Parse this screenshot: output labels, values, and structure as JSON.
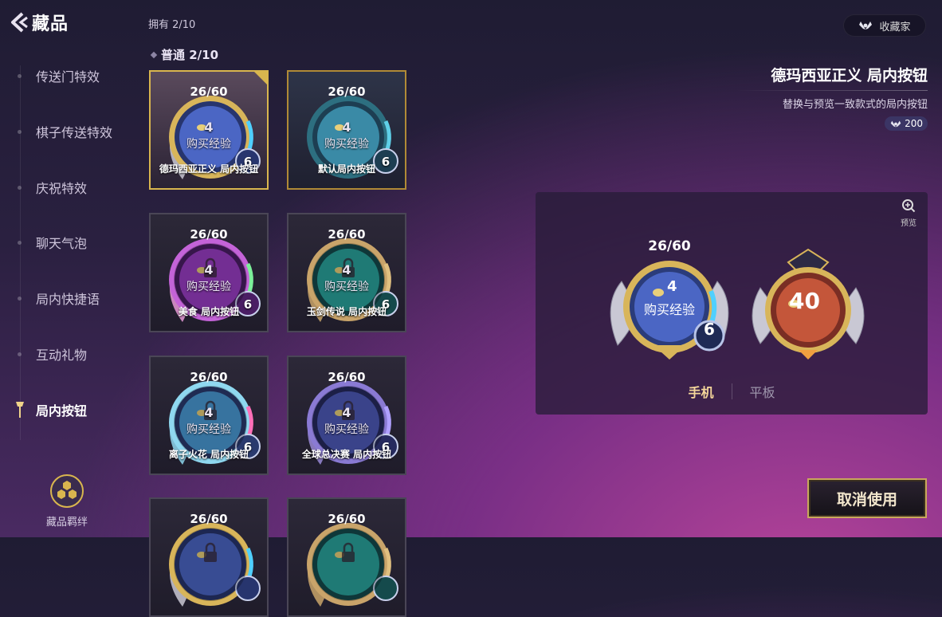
{
  "header": {
    "title": "藏品",
    "owned": "拥有 2/10",
    "collector_button": "收藏家"
  },
  "sidebar": {
    "items": [
      {
        "label": "传送门特效",
        "active": false
      },
      {
        "label": "棋子传送特效",
        "active": false
      },
      {
        "label": "庆祝特效",
        "active": false
      },
      {
        "label": "聊天气泡",
        "active": false
      },
      {
        "label": "局内快捷语",
        "active": false
      },
      {
        "label": "互动礼物",
        "active": false
      },
      {
        "label": "局内按钮",
        "active": true
      }
    ],
    "bond_label": "藏品羁绊"
  },
  "grid": {
    "section_label": "普通 2/10",
    "cards": [
      {
        "count": "26/60",
        "coin": "4",
        "buy": "购买经验",
        "level": "6",
        "name": "德玛西亚正义  局内按钮",
        "theme": "demacia",
        "state": "equipped"
      },
      {
        "count": "26/60",
        "coin": "4",
        "buy": "购买经验",
        "level": "6",
        "name": "默认局内按钮",
        "theme": "default",
        "state": "owned"
      },
      {
        "count": "26/60",
        "coin": "4",
        "buy": "购买经验",
        "level": "6",
        "name": "美食  局内按钮",
        "theme": "purple",
        "state": "locked"
      },
      {
        "count": "26/60",
        "coin": "4",
        "buy": "购买经验",
        "level": "6",
        "name": "玉剑传说  局内按钮",
        "theme": "teal",
        "state": "locked"
      },
      {
        "count": "26/60",
        "coin": "4",
        "buy": "购买经验",
        "level": "6",
        "name": "离子火花  局内按钮",
        "theme": "ion",
        "state": "locked"
      },
      {
        "count": "26/60",
        "coin": "4",
        "buy": "购买经验",
        "level": "6",
        "name": "全球总决赛  局内按钮",
        "theme": "worlds",
        "state": "locked"
      },
      {
        "count": "26/60",
        "coin": "",
        "buy": "",
        "level": "",
        "name": "",
        "theme": "demacia",
        "state": "locked"
      },
      {
        "count": "26/60",
        "coin": "",
        "buy": "",
        "level": "",
        "name": "",
        "theme": "teal",
        "state": "locked"
      }
    ]
  },
  "detail": {
    "title": "德玛西亚正义  局内按钮",
    "description": "替换与预览一致款式的局内按钮",
    "price": "200",
    "preview": {
      "zoom_label": "预览",
      "left_count": "26/60",
      "left_coin": "4",
      "left_buy": "购买经验",
      "left_level": "6",
      "right_coin": "40"
    },
    "tabs": [
      "手机",
      "平板"
    ],
    "active_tab": 0
  },
  "cancel_button": "取消使用",
  "colors": {
    "accent_gold": "#d9b64e",
    "tab_active": "#f4d69a"
  }
}
